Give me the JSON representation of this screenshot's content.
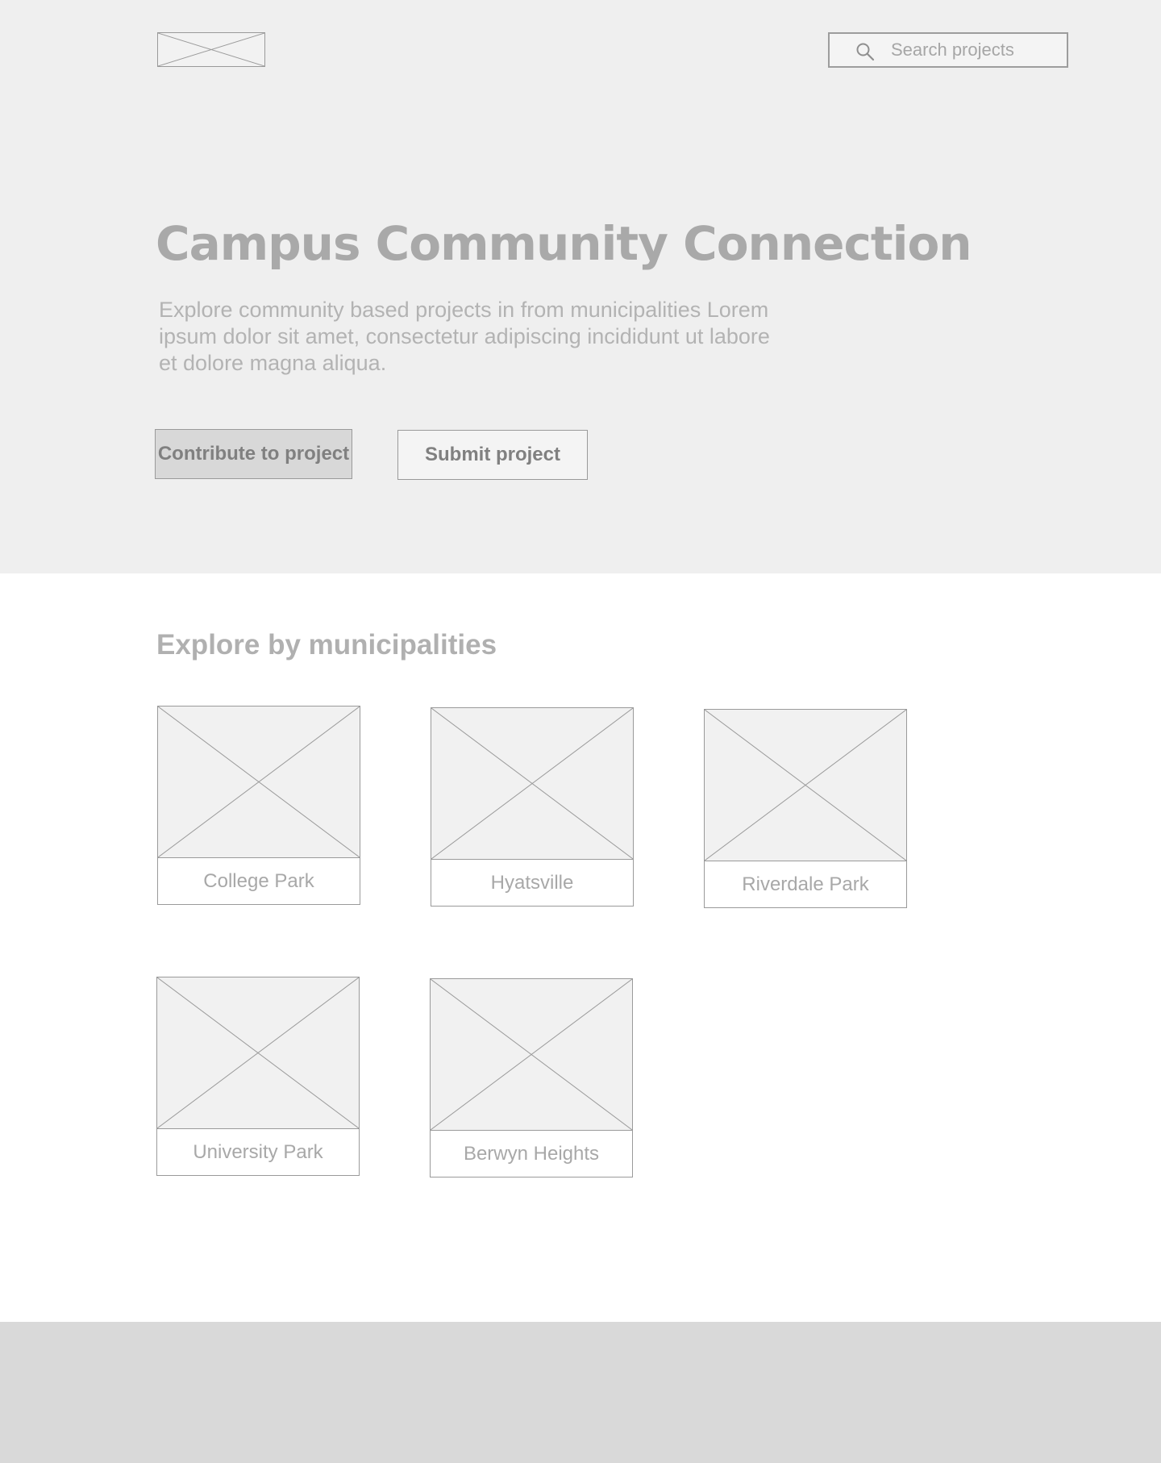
{
  "header": {
    "logo_icon": "image-placeholder-icon",
    "search": {
      "icon": "search-icon",
      "placeholder": "Search projects",
      "value": ""
    }
  },
  "hero": {
    "title": "Campus Community Connection",
    "subtitle": "Explore community based projects in from municipalities Lorem ipsum dolor sit amet, consectetur adipiscing incididunt ut labore et dolore magna aliqua.",
    "primary_button": "Contribute to project",
    "secondary_button": "Submit project"
  },
  "municipalities": {
    "title": "Explore by municipalities",
    "items": [
      {
        "label": "College Park"
      },
      {
        "label": "Hyatsville"
      },
      {
        "label": "Riverdale Park"
      },
      {
        "label": "University Park"
      },
      {
        "label": "Berwyn Heights"
      }
    ]
  },
  "colors": {
    "hero_background": "#efefef",
    "footer_background": "#d9d9d9",
    "primary_button_background": "#d8d8d8",
    "text_gray": "#a9a9a9"
  }
}
